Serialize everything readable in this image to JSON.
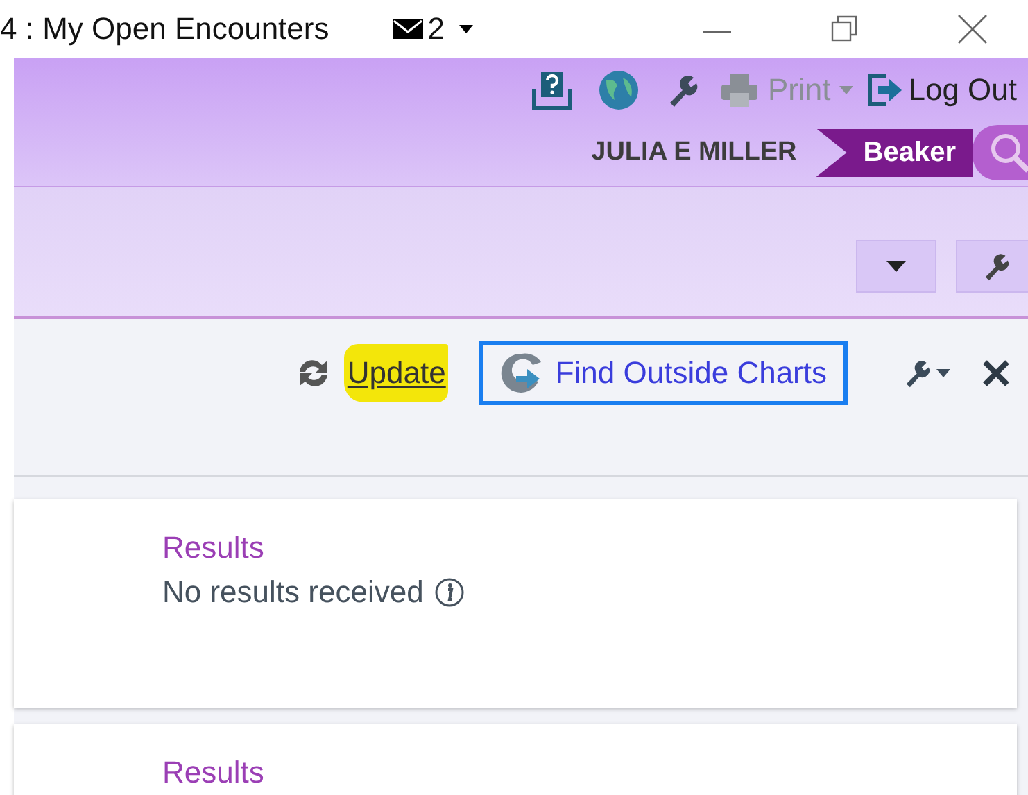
{
  "window": {
    "title": "4 : My Open Encounters",
    "mail_count": "2"
  },
  "header": {
    "print_label": "Print",
    "logout_label": "Log Out",
    "user_name": "JULIA E MILLER",
    "app_badge": "Beaker"
  },
  "toolbar": {
    "update": {
      "label": "Update",
      "highlighted": true
    },
    "find_outside": {
      "label": "Find Outside Charts",
      "focused": true
    }
  },
  "cards": [
    {
      "title": "Results",
      "message": "No results received"
    },
    {
      "title": "Results"
    }
  ]
}
